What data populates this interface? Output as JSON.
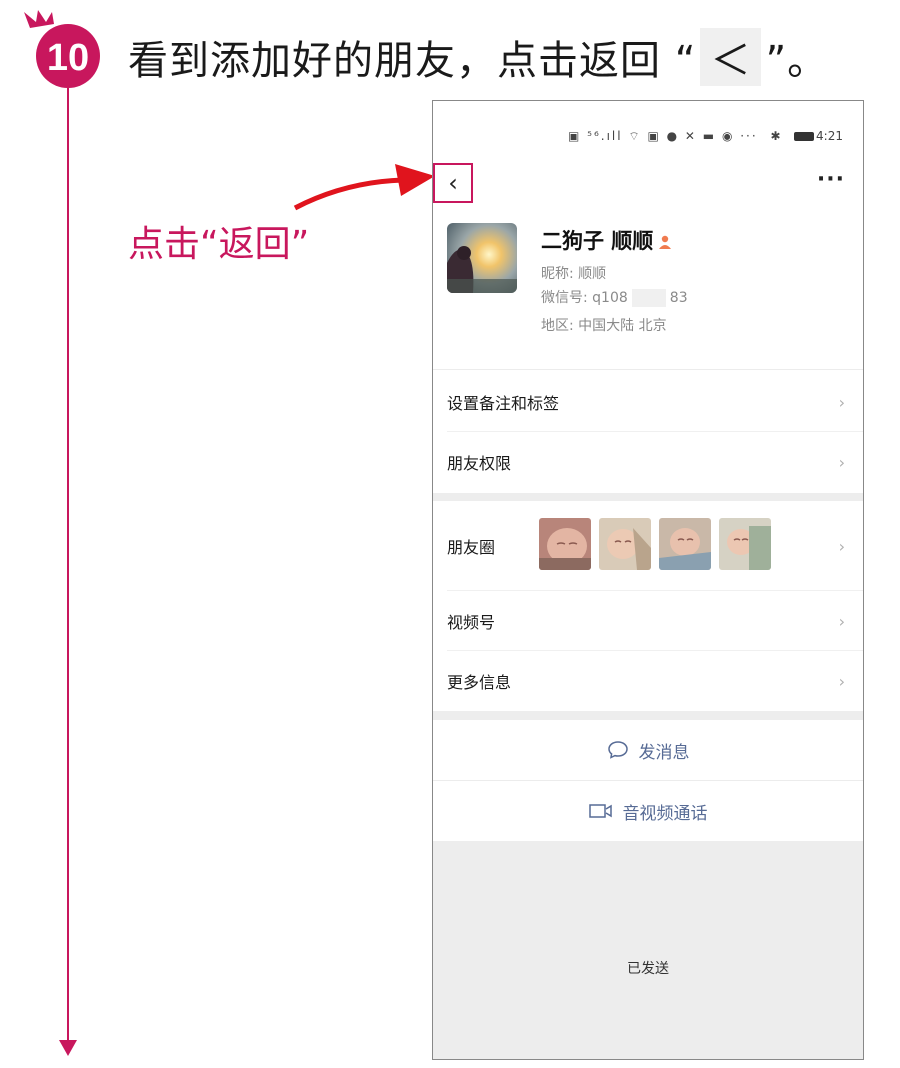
{
  "tutorial": {
    "step_number": "10",
    "instruction_pre": "看到添加好的朋友，点击返回 “",
    "instruction_glyph": "＜",
    "instruction_post": "”。",
    "annotation": "点击“返回”",
    "accent_color": "#c8175d"
  },
  "statusbar": {
    "icons": "▣ ⁵⁶.ıll ⌔ ▣ ● ✕ ▬ ◉ ···",
    "bluetooth": "✱",
    "time": "4:21"
  },
  "navbar": {
    "back_glyph": "‹",
    "more_glyph": "···"
  },
  "profile": {
    "name": "二狗子 顺顺",
    "nickname_label": "昵称: 顺顺",
    "wechat_id_prefix": "微信号: q108",
    "wechat_id_suffix": "83",
    "region": "地区: 中国大陆 北京"
  },
  "menu": {
    "remarks": "设置备注和标签",
    "permissions": "朋友权限",
    "moments": "朋友圈",
    "channels": "视频号",
    "more_info": "更多信息",
    "chevron": "›"
  },
  "actions": {
    "message": "发消息",
    "call": "音视频通话"
  },
  "toast": {
    "sent": "已发送"
  }
}
